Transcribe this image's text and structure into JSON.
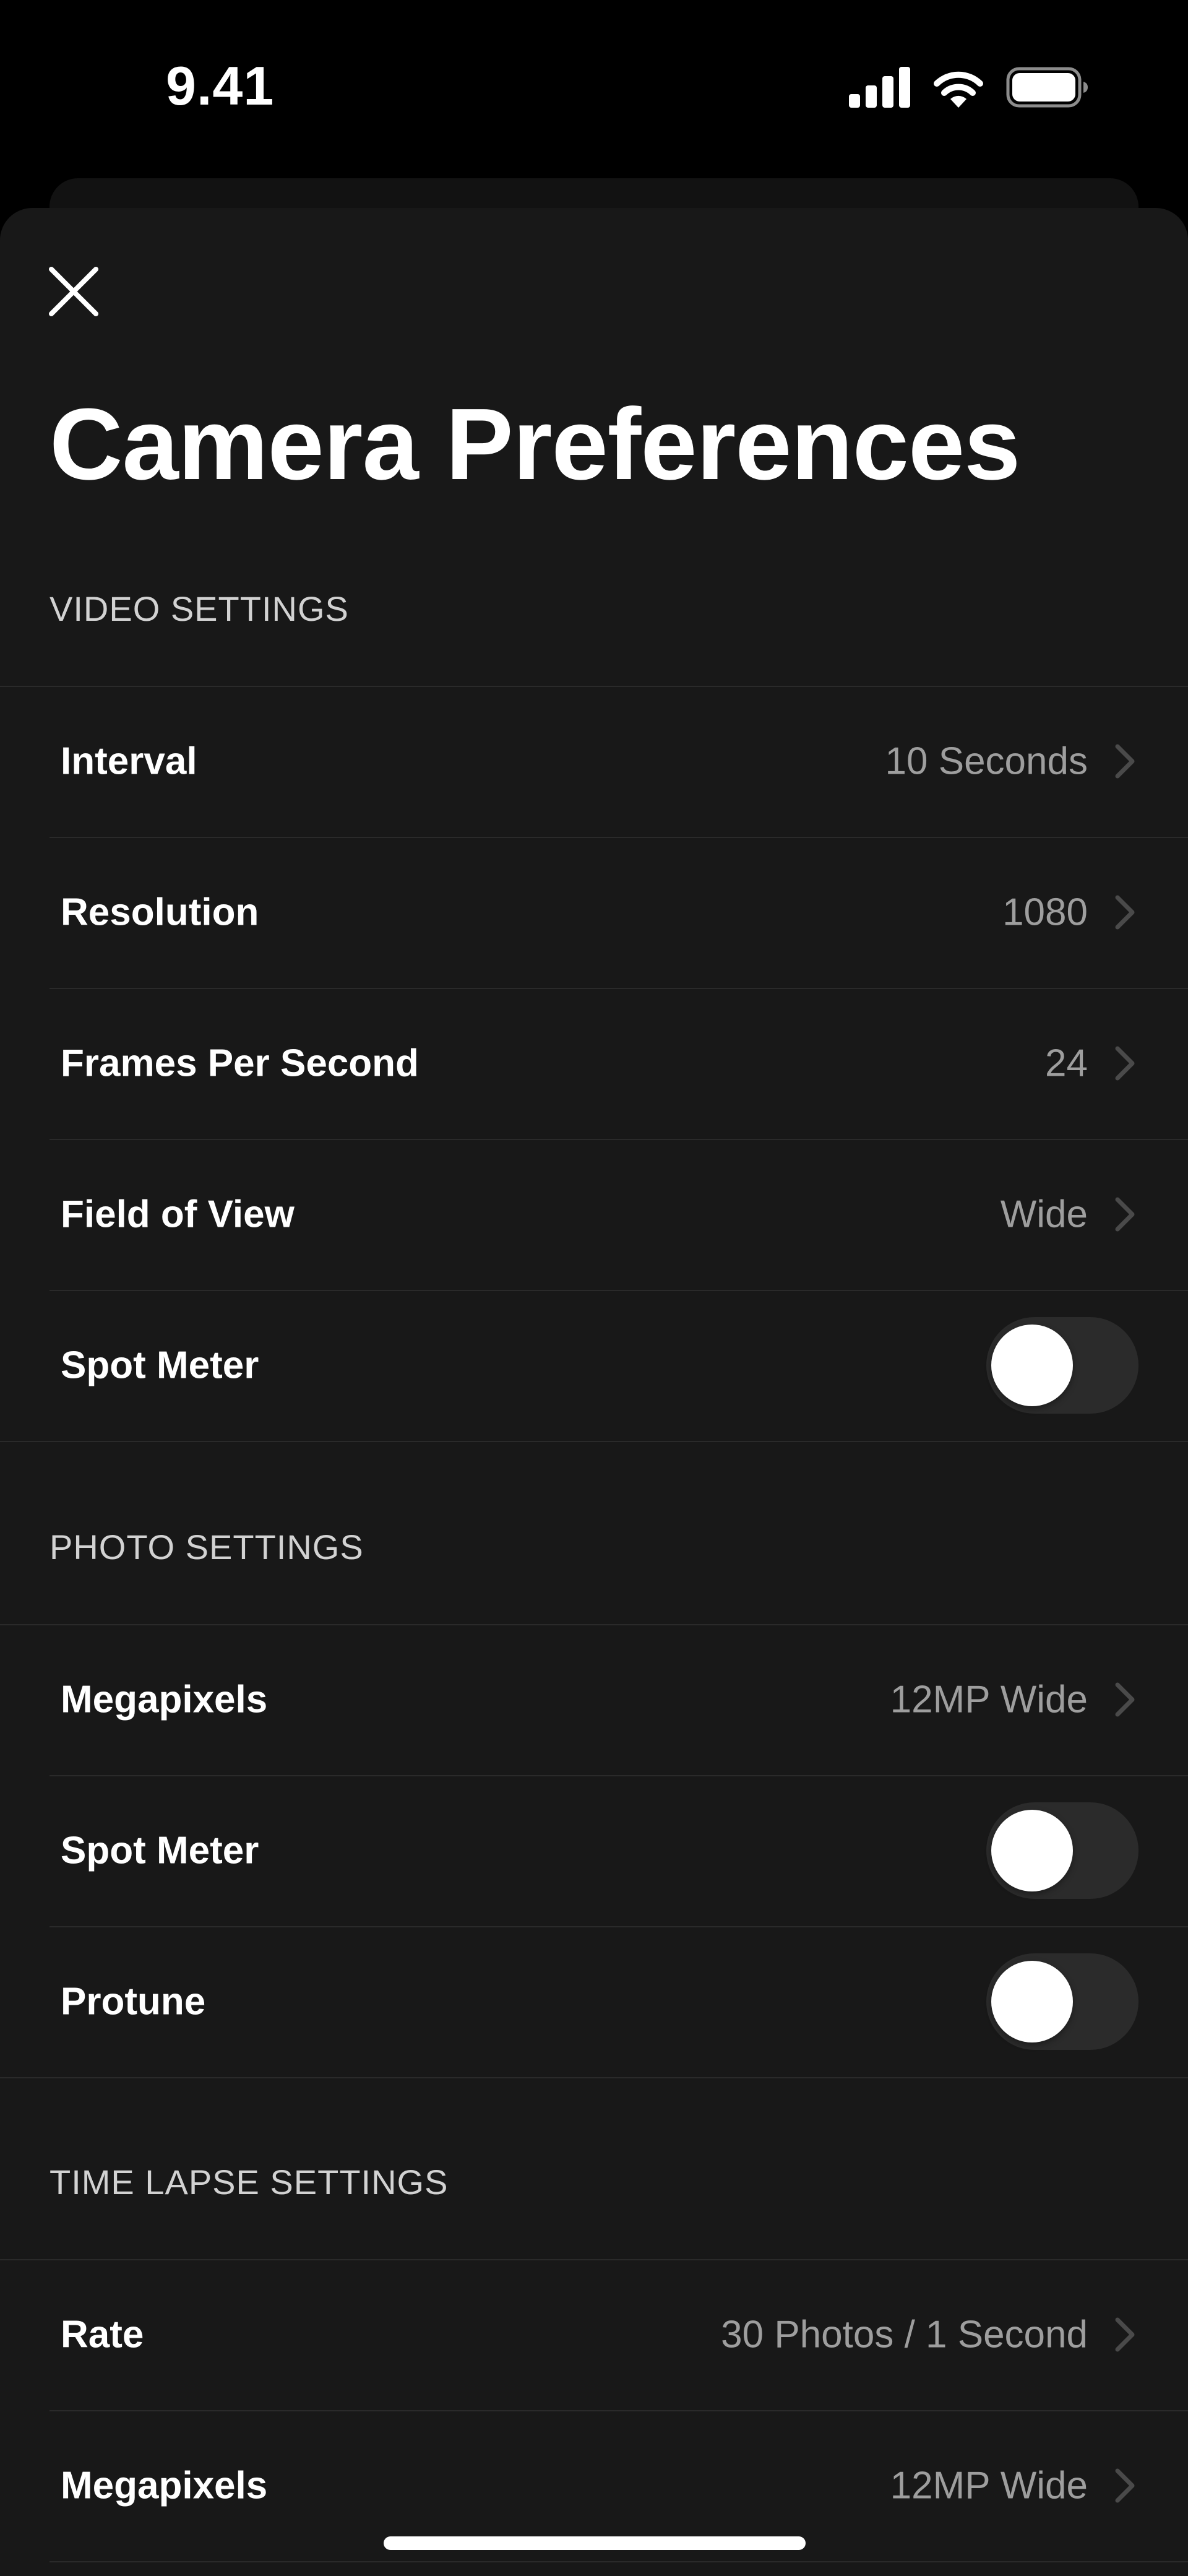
{
  "status_bar": {
    "time": "9.41",
    "icons": [
      "cellular-signal-icon",
      "wifi-icon",
      "battery-icon"
    ]
  },
  "header": {
    "close_icon": "close-icon",
    "title": "Camera Preferences"
  },
  "sections": {
    "video": {
      "title": "VIDEO SETTINGS",
      "interval": {
        "label": "Interval",
        "value": "10 Seconds"
      },
      "resolution": {
        "label": "Resolution",
        "value": "1080"
      },
      "fps": {
        "label": "Frames Per Second",
        "value": "24"
      },
      "fov": {
        "label": "Field of View",
        "value": "Wide"
      },
      "spot_meter": {
        "label": "Spot Meter",
        "enabled": false
      }
    },
    "photo": {
      "title": "PHOTO SETTINGS",
      "megapixels": {
        "label": "Megapixels",
        "value": "12MP Wide"
      },
      "spot_meter": {
        "label": "Spot Meter",
        "enabled": false
      },
      "protune": {
        "label": "Protune",
        "enabled": false
      }
    },
    "time_lapse": {
      "title": "TIME LAPSE SETTINGS",
      "rate": {
        "label": "Rate",
        "value": "30 Photos / 1 Second"
      },
      "megapixels": {
        "label": "Megapixels",
        "value": "12MP Wide"
      }
    }
  },
  "colors": {
    "background": "#000000",
    "sheet": "#181818",
    "text_primary": "#ffffff",
    "text_secondary": "#9e9e9e",
    "toggle_off_track": "#2b2b2b"
  }
}
